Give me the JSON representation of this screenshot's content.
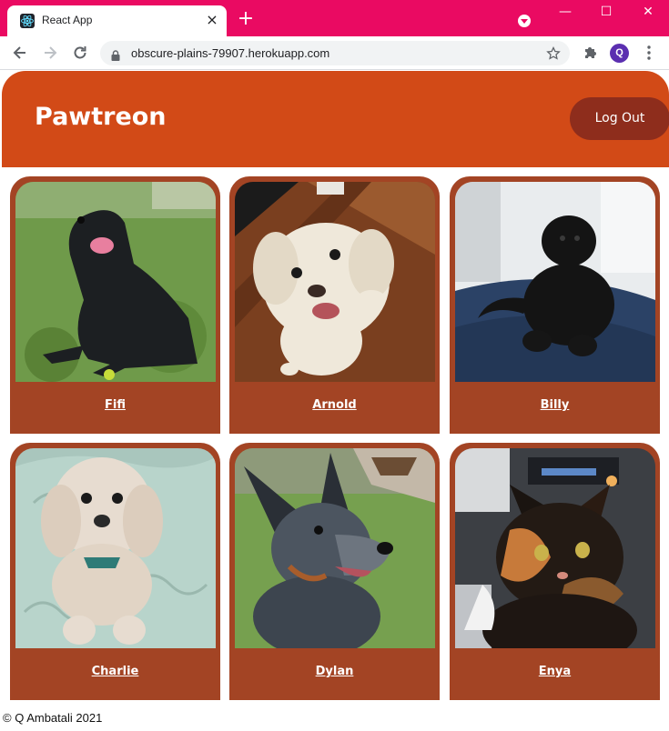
{
  "browser": {
    "tab_title": "React App",
    "tab_close": "×",
    "new_tab": "+",
    "url": "obscure-plains-79907.herokuapp.com",
    "profile_initial": "Q",
    "window_minimize": "—",
    "window_maximize": "☐",
    "window_close": "✕",
    "theme_color": "#ea0a62"
  },
  "header": {
    "brand": "Pawtreon",
    "logout_label": "Log Out",
    "color": "#d24a17"
  },
  "pets": [
    {
      "name": "Fifi",
      "icon": "black-dog-on-grass-photo"
    },
    {
      "name": "Arnold",
      "icon": "white-fluffy-dog-photo"
    },
    {
      "name": "Billy",
      "icon": "black-poodle-photo"
    },
    {
      "name": "Charlie",
      "icon": "cream-fluffy-dog-photo"
    },
    {
      "name": "Dylan",
      "icon": "cattle-dog-photo"
    },
    {
      "name": "Enya",
      "icon": "tortoiseshell-cat-photo"
    }
  ],
  "card_color": "#a34424",
  "footer": {
    "text": "© Q Ambatali 2021"
  }
}
